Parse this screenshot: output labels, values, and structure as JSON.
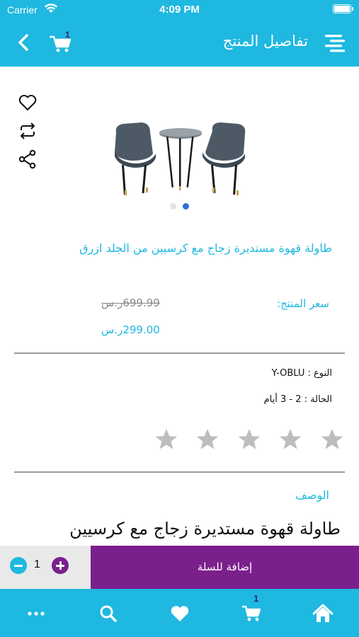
{
  "status_bar": {
    "carrier": "Carrier",
    "time": "4:09 PM"
  },
  "header": {
    "title": "تفاصيل المنتج",
    "cart_badge": "1",
    "back_icon": "chevron-left-icon",
    "cart_icon": "cart-icon",
    "menu_icon": "menu-icon"
  },
  "product": {
    "name": "طاولة قهوة مستديرة زجاج مع كرسيين من الجلد ازرق",
    "image_icon": "table-with-chairs-image",
    "gallery_dots": 2,
    "active_dot": 2,
    "price_label": "سعر المنتج:",
    "old_price": "699.99ر.س",
    "new_price": "299.00ر.س",
    "type_label": "النوع :",
    "type_value": "Y-OBLU",
    "status_label": "الحالة :",
    "status_value": "2 - 3 أيام",
    "rating": 0,
    "rating_max": 5,
    "description_label": "الوصف",
    "description_text": "طاولة قهوة مستديرة زجاج مع كرسيين"
  },
  "actions": {
    "favorite_icon": "heart-outline-icon",
    "compare_icon": "repeat-icon",
    "share_icon": "share-icon"
  },
  "cart_bar": {
    "quantity": "1",
    "add_to_cart_label": "إضافة للسلة"
  },
  "tab_bar": {
    "cart_badge": "1",
    "items": [
      "more-icon",
      "search-icon",
      "heart-icon",
      "cart-icon",
      "home-icon"
    ]
  },
  "colors": {
    "primary": "#1fb8e0",
    "accent": "#7b1f8c",
    "star_empty": "#bdbdbd"
  }
}
